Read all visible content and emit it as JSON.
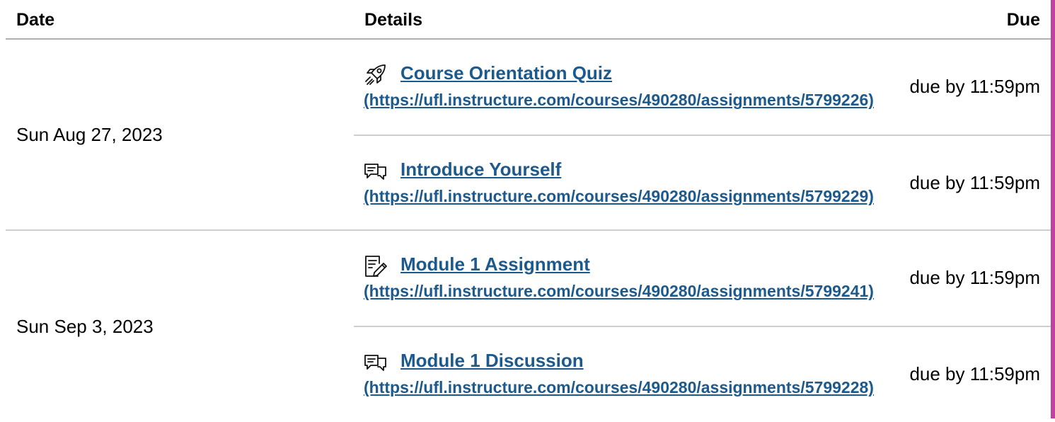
{
  "table": {
    "headers": {
      "date": "Date",
      "details": "Details",
      "due": "Due"
    },
    "groups": [
      {
        "date": "Sun Aug 27, 2023",
        "items": [
          {
            "icon": "quiz-rocket-icon",
            "title": "Course Orientation Quiz",
            "url": "(https://ufl.instructure.com/courses/490280/assignments/5799226)",
            "due": "due by 11:59pm"
          },
          {
            "icon": "discussion-icon",
            "title": "Introduce Yourself",
            "url": "(https://ufl.instructure.com/courses/490280/assignments/5799229)",
            "due": "due by 11:59pm"
          }
        ]
      },
      {
        "date": "Sun Sep 3, 2023",
        "items": [
          {
            "icon": "assignment-icon",
            "title": "Module 1 Assignment",
            "url": "(https://ufl.instructure.com/courses/490280/assignments/5799241)",
            "due": "due by 11:59pm"
          },
          {
            "icon": "discussion-icon",
            "title": "Module 1 Discussion",
            "url": "(https://ufl.instructure.com/courses/490280/assignments/5799228)",
            "due": "due by 11:59pm"
          }
        ]
      }
    ]
  },
  "colors": {
    "link": "#1c5a8e",
    "accent_bar": "#c23fa5",
    "header_border": "#b0b0b0",
    "row_border": "#cfcfcf"
  }
}
